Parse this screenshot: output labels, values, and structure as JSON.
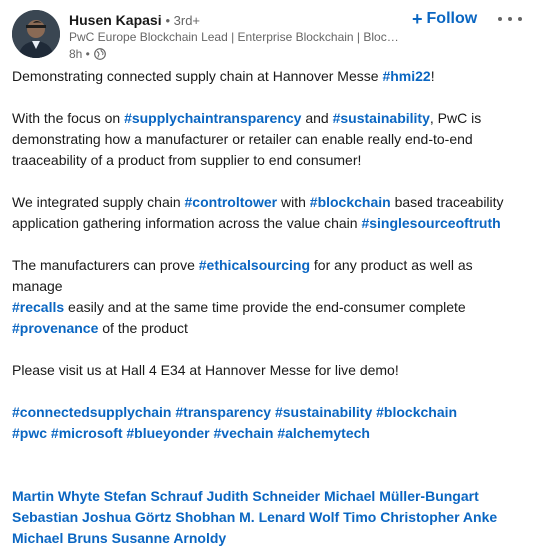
{
  "actor": {
    "name": "Husen Kapasi",
    "degree": "• 3rd+",
    "headline": "PwC Europe Blockchain Lead | Enterprise Blockchain | Blockc...",
    "time": "8h •",
    "visibility_icon": "globe-icon"
  },
  "actions": {
    "follow_icon": "+",
    "follow_label": "Follow",
    "more_icon": "more-icon"
  },
  "post": {
    "p1": {
      "t1": "Demonstrating connected supply chain at Hannover Messe ",
      "h1": "#hmi22",
      "t2": "!"
    },
    "p2": {
      "t1": "With the focus on ",
      "h1": "#supplychaintransparency",
      "t2": " and ",
      "h2": "#sustainability",
      "t3": ", PwC is demonstrating how a manufacturer or retailer can enable really end-to-end traaceability of a product from supplier to end consumer!"
    },
    "p3": {
      "t1": "We integrated supply chain ",
      "h1": "#controltower",
      "t2": " with ",
      "h2": "#blockchain",
      "t3": " based traceability application gathering information across the value chain ",
      "h3": "#singlesourceoftruth"
    },
    "p4": {
      "t1": "The manufacturers can prove ",
      "h1": "#ethicalsourcing",
      "t2": " for any product as well as manage ",
      "h2": "#recalls",
      "t3": " easily and at the same time provide the end-consumer complete ",
      "h3": "#provenance",
      "t4": " of the product"
    },
    "p5": "Please visit us at Hall 4 E34 at Hannover Messe for live demo!",
    "tags_line1": [
      "#connectedsupplychain",
      "#transparency",
      "#sustainability",
      "#blockchain"
    ],
    "tags_line2": [
      "#pwc",
      "#microsoft",
      "#blueyonder",
      "#vechain",
      "#alchemytech"
    ],
    "mentions": [
      "Martin Whyte",
      "Stefan Schrauf",
      "Judith Schneider",
      "Michael Müller-Bungart",
      "Sebastian Joshua Görtz",
      "Shobhan M.",
      "Lenard Wolf",
      "Timo Christopher Anke",
      "Michael Bruns",
      "Susanne Arnoldy"
    ]
  },
  "colors": {
    "link": "#0a66c2",
    "text": "#191919",
    "muted": "#666666"
  }
}
